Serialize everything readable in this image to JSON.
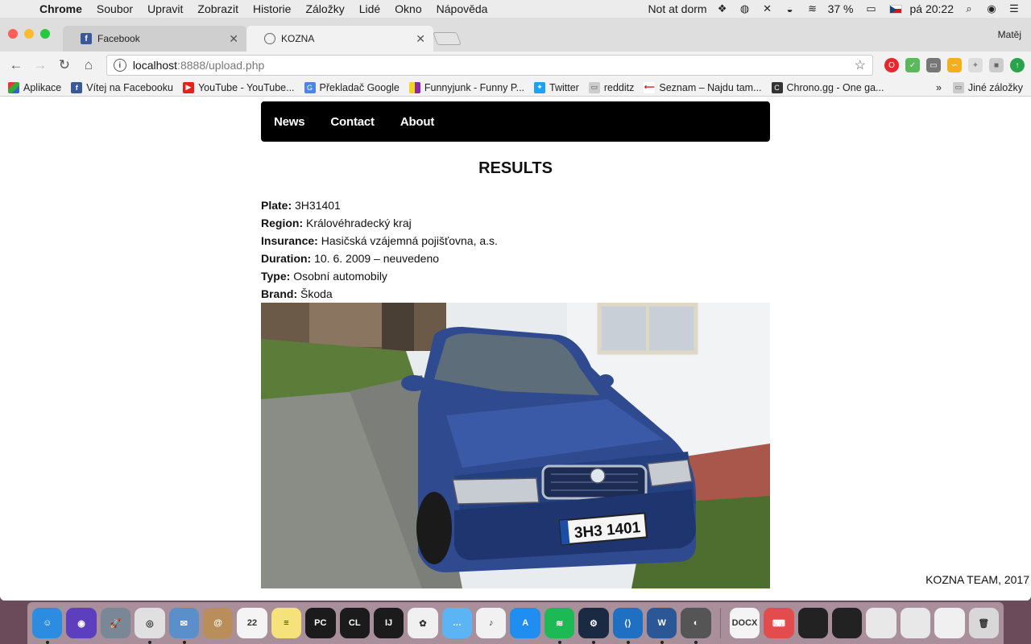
{
  "menubar": {
    "app": "Chrome",
    "items": [
      "Soubor",
      "Upravit",
      "Zobrazit",
      "Historie",
      "Záložky",
      "Lidé",
      "Okno",
      "Nápověda"
    ],
    "status_text": "Not at dorm",
    "battery": "37 %",
    "clock": "pá 20:22"
  },
  "browser": {
    "tabs": [
      {
        "title": "Facebook",
        "icon": "facebook-icon"
      },
      {
        "title": "KOZNA",
        "icon": "kozna-icon"
      }
    ],
    "profile": "Matěj",
    "url_host": "localhost",
    "url_path": ":8888/upload.php",
    "bookmarks": [
      {
        "label": "Aplikace",
        "icon": "apps-grid-icon"
      },
      {
        "label": "Vítej na Facebooku",
        "icon": "facebook-icon"
      },
      {
        "label": "YouTube - YouTube...",
        "icon": "youtube-icon"
      },
      {
        "label": "Překladač Google",
        "icon": "google-translate-icon"
      },
      {
        "label": "Funnyjunk - Funny P...",
        "icon": "funnyjunk-icon"
      },
      {
        "label": "Twitter",
        "icon": "twitter-icon"
      },
      {
        "label": "redditz",
        "icon": "folder-icon"
      },
      {
        "label": "Seznam – Najdu tam...",
        "icon": "seznam-icon"
      },
      {
        "label": "Chrono.gg - One ga...",
        "icon": "chrono-icon"
      }
    ],
    "bookmarks_more": "»",
    "other_bookmarks": "Jiné záložky"
  },
  "page": {
    "nav": [
      "News",
      "Contact",
      "About"
    ],
    "title": "RESULTS",
    "fields": [
      {
        "label": "Plate:",
        "value": "3H31401"
      },
      {
        "label": "Region:",
        "value": "Královéhradecký kraj"
      },
      {
        "label": "Insurance:",
        "value": "Hasičská vzájemná pojišťovna, a.s."
      },
      {
        "label": "Duration:",
        "value": "10. 6. 2009 – neuvedeno"
      },
      {
        "label": "Type:",
        "value": "Osobní automobily"
      },
      {
        "label": "Brand:",
        "value": "Škoda"
      }
    ],
    "photo_plate_text": "3H3 1401",
    "footer": "KOZNA TEAM, 2017"
  },
  "dock": {
    "apps": [
      {
        "name": "finder",
        "color": "#2c8de0",
        "label": "☺",
        "running": true
      },
      {
        "name": "siri",
        "color": "#5b3fbf",
        "label": "◉",
        "running": false
      },
      {
        "name": "launchpad",
        "color": "#7a8796",
        "label": "🚀",
        "running": false
      },
      {
        "name": "chrome",
        "color": "#e0e0e0",
        "label": "◎",
        "running": true
      },
      {
        "name": "preview",
        "color": "#5a8fc9",
        "label": "✉",
        "running": true
      },
      {
        "name": "contacts",
        "color": "#b98e5a",
        "label": "@",
        "running": false
      },
      {
        "name": "calendar",
        "color": "#f4f4f4",
        "label": "22",
        "running": false
      },
      {
        "name": "notes",
        "color": "#f5e27a",
        "label": "≡",
        "running": false
      },
      {
        "name": "pycharm",
        "color": "#1b1b1b",
        "label": "PC",
        "running": false
      },
      {
        "name": "clion",
        "color": "#1b1b1b",
        "label": "CL",
        "running": false
      },
      {
        "name": "intellij",
        "color": "#1b1b1b",
        "label": "IJ",
        "running": false
      },
      {
        "name": "photos",
        "color": "#f0f0f0",
        "label": "✿",
        "running": false
      },
      {
        "name": "messages",
        "color": "#5cb4f5",
        "label": "…",
        "running": false
      },
      {
        "name": "itunes",
        "color": "#f1f1f1",
        "label": "♪",
        "running": false
      },
      {
        "name": "app-store",
        "color": "#1f8ef0",
        "label": "A",
        "running": false
      },
      {
        "name": "spotify",
        "color": "#1db954",
        "label": "≋",
        "running": true
      },
      {
        "name": "steam",
        "color": "#1a2a43",
        "label": "⚙",
        "running": true
      },
      {
        "name": "vscode",
        "color": "#1f6fc2",
        "label": "⟨⟩",
        "running": true
      },
      {
        "name": "word",
        "color": "#2b5797",
        "label": "W",
        "running": true
      },
      {
        "name": "bear-app",
        "color": "#555",
        "label": "◐",
        "running": true
      }
    ],
    "right_items": [
      {
        "name": "dock-file",
        "color": "#f4f4f4",
        "label": "DOCX"
      },
      {
        "name": "keyboard-app",
        "color": "#e24c4c",
        "label": "⌨"
      },
      {
        "name": "thumb-1",
        "color": "#222",
        "label": ""
      },
      {
        "name": "thumb-2",
        "color": "#222",
        "label": ""
      },
      {
        "name": "thumb-3",
        "color": "#e8e8e8",
        "label": ""
      },
      {
        "name": "thumb-4",
        "color": "#e8e8e8",
        "label": ""
      },
      {
        "name": "thumb-5",
        "color": "#f0f0f0",
        "label": ""
      },
      {
        "name": "trash",
        "color": "#d8d8d8",
        "label": "🗑"
      }
    ]
  }
}
